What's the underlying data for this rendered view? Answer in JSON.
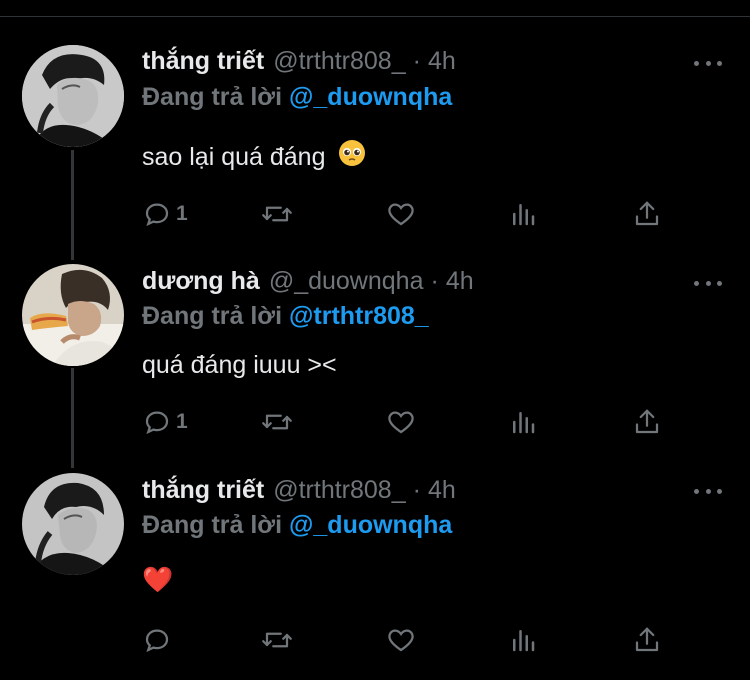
{
  "reply_prefix": "Đang trả lời",
  "tweets": [
    {
      "author_name": "thắng triết",
      "author_handle": "@trthtr808_",
      "separator": "·",
      "time": "4h",
      "reply_to": "@_duownqha",
      "text": "sao lại quá đáng",
      "emoji": "pleading-face",
      "reply_count": "1",
      "avatar": "avatar-thang-triet"
    },
    {
      "author_name": "dương hà",
      "author_handle": "@_duownqha",
      "separator": "·",
      "time": "4h",
      "reply_to": "@trthtr808_",
      "text": "quá đáng iuuu ><",
      "reply_count": "1",
      "avatar": "avatar-duong-ha"
    },
    {
      "author_name": "thắng triết",
      "author_handle": "@trthtr808_",
      "separator": "·",
      "time": "4h",
      "reply_to": "@_duownqha",
      "text": "❤️",
      "reply_count": "",
      "avatar": "avatar-thang-triet"
    }
  ],
  "colors": {
    "background": "#000000",
    "primary_text": "#e7e9ea",
    "secondary_text": "#71767b",
    "mention": "#1d9bf0",
    "thread_line": "#333639"
  },
  "icons": [
    "reply-icon",
    "retweet-icon",
    "like-icon",
    "analytics-icon",
    "share-icon",
    "more-icon"
  ]
}
